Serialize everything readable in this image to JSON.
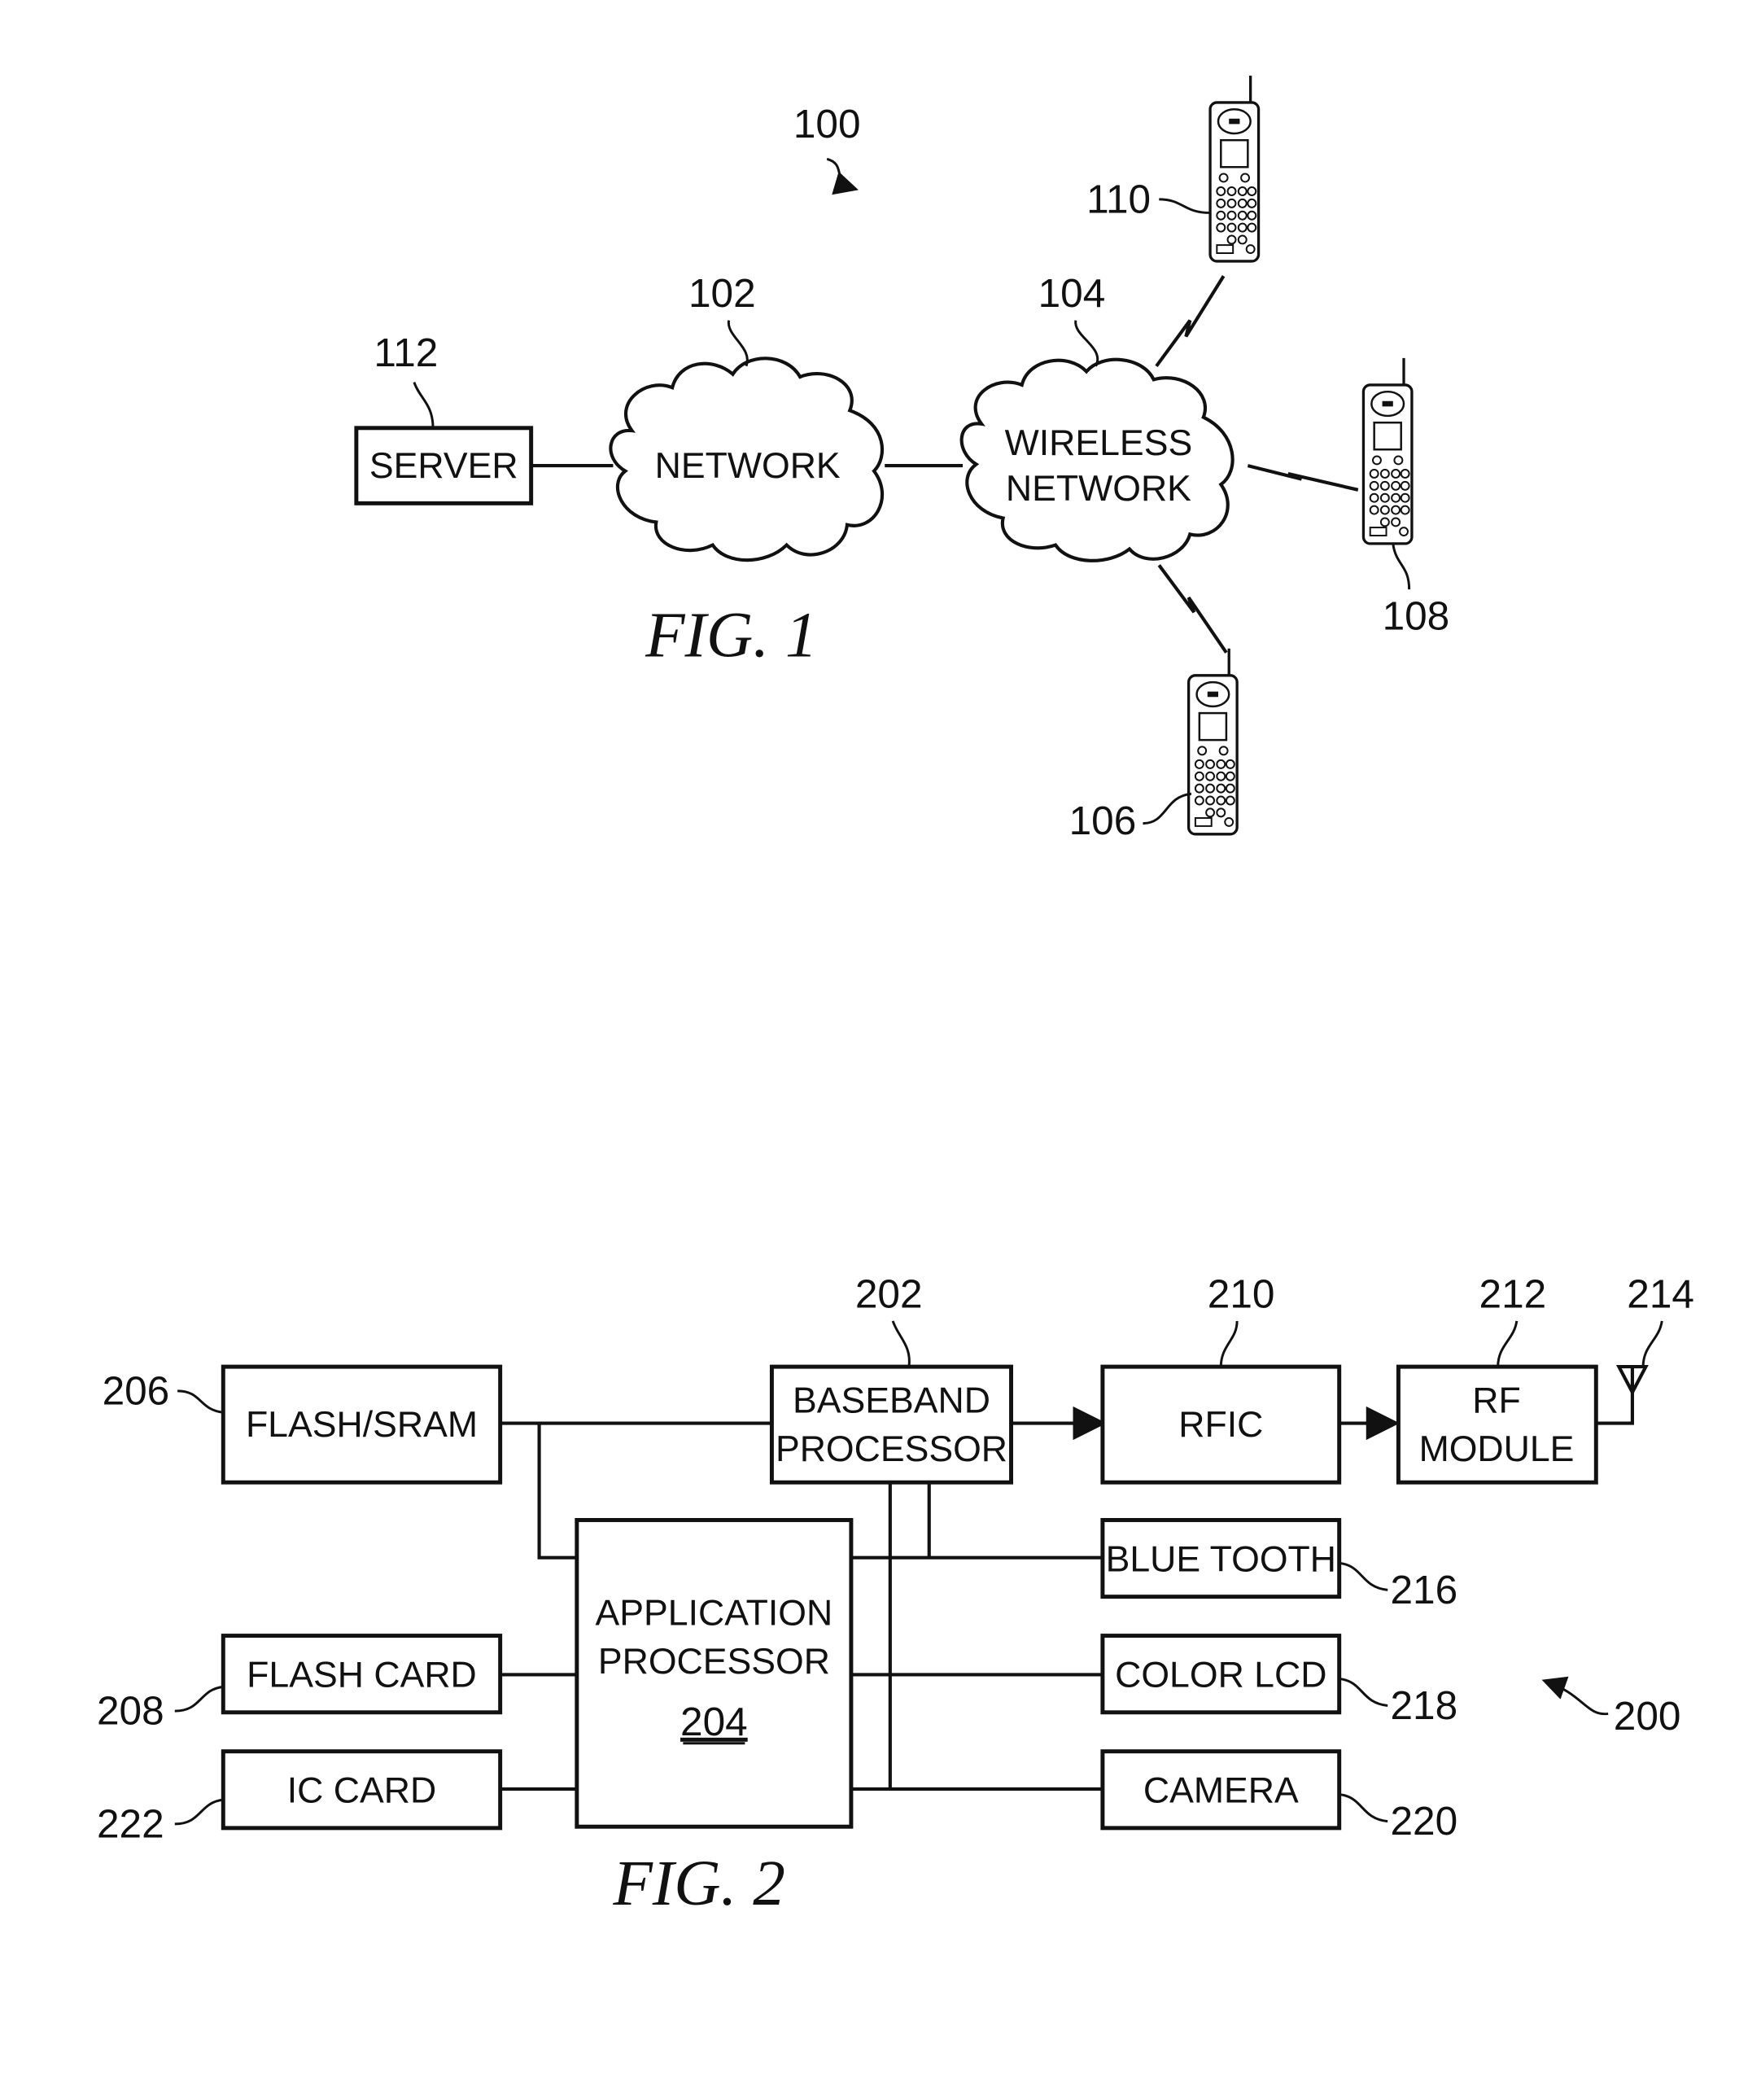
{
  "fig1": {
    "caption": "FIG. 1",
    "system_ref": "100",
    "server": {
      "label": "SERVER",
      "ref": "112"
    },
    "network": {
      "label": "NETWORK",
      "ref": "102"
    },
    "wireless_network": {
      "label_line1": "WIRELESS",
      "label_line2": "NETWORK",
      "ref": "104"
    },
    "phones": [
      {
        "ref": "110"
      },
      {
        "ref": "108"
      },
      {
        "ref": "106"
      }
    ]
  },
  "fig2": {
    "caption": "FIG. 2",
    "system_ref": "200",
    "blocks": {
      "flash_sram": {
        "label": "FLASH/SRAM",
        "ref": "206"
      },
      "baseband": {
        "label_line1": "BASEBAND",
        "label_line2": "PROCESSOR",
        "ref": "202"
      },
      "rfic": {
        "label": "RFIC",
        "ref": "210"
      },
      "rf_module": {
        "label_line1": "RF",
        "label_line2": "MODULE",
        "ref": "212"
      },
      "antenna": {
        "ref": "214"
      },
      "app_processor": {
        "label_line1": "APPLICATION",
        "label_line2": "PROCESSOR",
        "label_ref": "204"
      },
      "flash_card": {
        "label": "FLASH CARD",
        "ref": "208"
      },
      "ic_card": {
        "label": "IC CARD",
        "ref": "222"
      },
      "bluetooth": {
        "label": "BLUE TOOTH",
        "ref": "216"
      },
      "color_lcd": {
        "label": "COLOR LCD",
        "ref": "218"
      },
      "camera": {
        "label": "CAMERA",
        "ref": "220"
      }
    }
  }
}
